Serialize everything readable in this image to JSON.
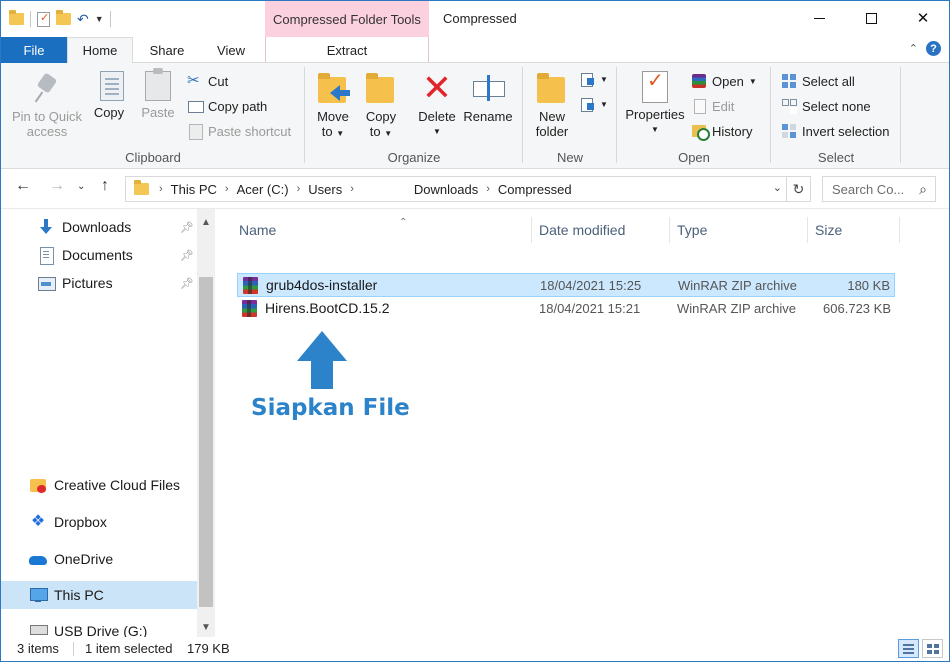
{
  "window": {
    "title": "Compressed",
    "context_tab_group": "Compressed Folder Tools"
  },
  "tabs": {
    "file": "File",
    "home": "Home",
    "share": "Share",
    "view": "View",
    "extract": "Extract"
  },
  "ribbon": {
    "clipboard": {
      "label": "Clipboard",
      "pin": "Pin to Quick\naccess",
      "pin_l1": "Pin to Quick",
      "pin_l2": "access",
      "copy": "Copy",
      "paste": "Paste",
      "cut": "Cut",
      "copy_path": "Copy path",
      "paste_shortcut": "Paste shortcut"
    },
    "organize": {
      "label": "Organize",
      "move_l1": "Move",
      "move_l2": "to",
      "copy_l1": "Copy",
      "copy_l2": "to",
      "delete": "Delete",
      "rename": "Rename"
    },
    "new": {
      "label": "New",
      "folder_l1": "New",
      "folder_l2": "folder"
    },
    "open": {
      "label": "Open",
      "properties": "Properties",
      "open": "Open",
      "edit": "Edit",
      "history": "History"
    },
    "select": {
      "label": "Select",
      "select_all": "Select all",
      "select_none": "Select none",
      "invert": "Invert selection"
    }
  },
  "address": {
    "crumbs": [
      "This PC",
      "Acer (C:)",
      "Users",
      "Downloads",
      "Compressed"
    ],
    "search_placeholder": "Search Co..."
  },
  "nav": {
    "quick_access": [
      {
        "label": "Downloads",
        "icon": "download-arrow-icon",
        "pinned": true
      },
      {
        "label": "Documents",
        "icon": "documents-icon",
        "pinned": true
      },
      {
        "label": "Pictures",
        "icon": "pictures-icon",
        "pinned": true
      }
    ],
    "locations": [
      {
        "label": "Creative Cloud Files",
        "icon": "creative-cloud-folder-icon"
      },
      {
        "label": "Dropbox",
        "icon": "dropbox-icon"
      },
      {
        "label": "OneDrive",
        "icon": "onedrive-cloud-icon"
      },
      {
        "label": "This PC",
        "icon": "computer-icon",
        "selected": true
      },
      {
        "label": "USB Drive (G:)",
        "icon": "usb-drive-icon"
      }
    ]
  },
  "columns": {
    "name": "Name",
    "date": "Date modified",
    "type": "Type",
    "size": "Size"
  },
  "files": [
    {
      "name": "grub4dos-installer",
      "date": "18/04/2021 15:25",
      "type": "WinRAR ZIP archive",
      "size": "180 KB",
      "selected": true,
      "icon": "winrar-archive-icon"
    },
    {
      "name": "Hirens.BootCD.15.2",
      "date": "18/04/2021 15:21",
      "type": "WinRAR ZIP archive",
      "size": "606.723 KB",
      "selected": false,
      "icon": "winrar-archive-icon"
    }
  ],
  "annotation": {
    "text": "Siapkan File",
    "color": "#2c83c9"
  },
  "status": {
    "items": "3 items",
    "selected": "1 item selected",
    "size": "179 KB"
  },
  "colors": {
    "accent": "#1a6fc0",
    "context_tab": "#fbd1e0",
    "selection": "#cce8ff"
  }
}
